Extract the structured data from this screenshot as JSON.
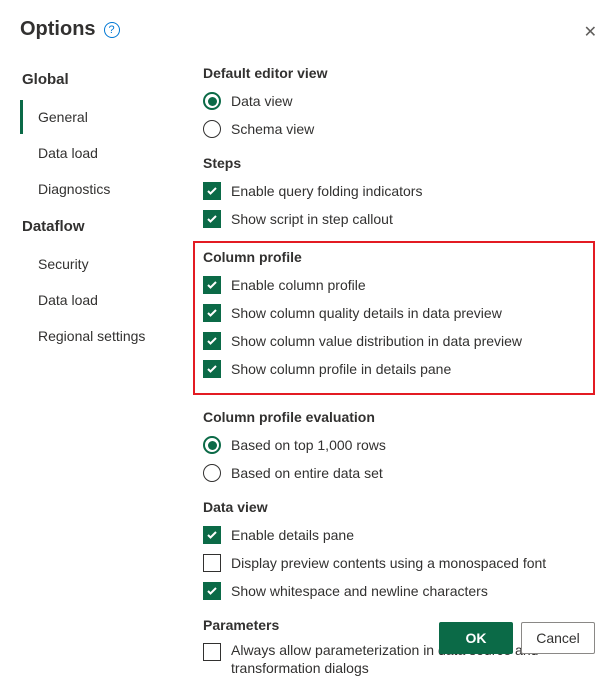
{
  "title": "Options",
  "sidebar": {
    "groups": [
      {
        "header": "Global",
        "items": [
          {
            "label": "General",
            "active": true
          },
          {
            "label": "Data load",
            "active": false
          },
          {
            "label": "Diagnostics",
            "active": false
          }
        ]
      },
      {
        "header": "Dataflow",
        "items": [
          {
            "label": "Security",
            "active": false
          },
          {
            "label": "Data load",
            "active": false
          },
          {
            "label": "Regional settings",
            "active": false
          }
        ]
      }
    ]
  },
  "sections": {
    "default_editor_view": {
      "title": "Default editor view",
      "options": [
        {
          "label": "Data view",
          "checked": true
        },
        {
          "label": "Schema view",
          "checked": false
        }
      ]
    },
    "steps": {
      "title": "Steps",
      "options": [
        {
          "label": "Enable query folding indicators",
          "checked": true
        },
        {
          "label": "Show script in step callout",
          "checked": true
        }
      ]
    },
    "column_profile": {
      "title": "Column profile",
      "options": [
        {
          "label": "Enable column profile",
          "checked": true
        },
        {
          "label": "Show column quality details in data preview",
          "checked": true
        },
        {
          "label": "Show column value distribution in data preview",
          "checked": true
        },
        {
          "label": "Show column profile in details pane",
          "checked": true
        }
      ]
    },
    "column_profile_evaluation": {
      "title": "Column profile evaluation",
      "options": [
        {
          "label": "Based on top 1,000 rows",
          "checked": true
        },
        {
          "label": "Based on entire data set",
          "checked": false
        }
      ]
    },
    "data_view": {
      "title": "Data view",
      "options": [
        {
          "label": "Enable details pane",
          "checked": true
        },
        {
          "label": "Display preview contents using a monospaced font",
          "checked": false
        },
        {
          "label": "Show whitespace and newline characters",
          "checked": true
        }
      ]
    },
    "parameters": {
      "title": "Parameters",
      "options": [
        {
          "label": "Always allow parameterization in data source and transformation dialogs",
          "checked": false
        }
      ]
    }
  },
  "buttons": {
    "ok": "OK",
    "cancel": "Cancel"
  }
}
